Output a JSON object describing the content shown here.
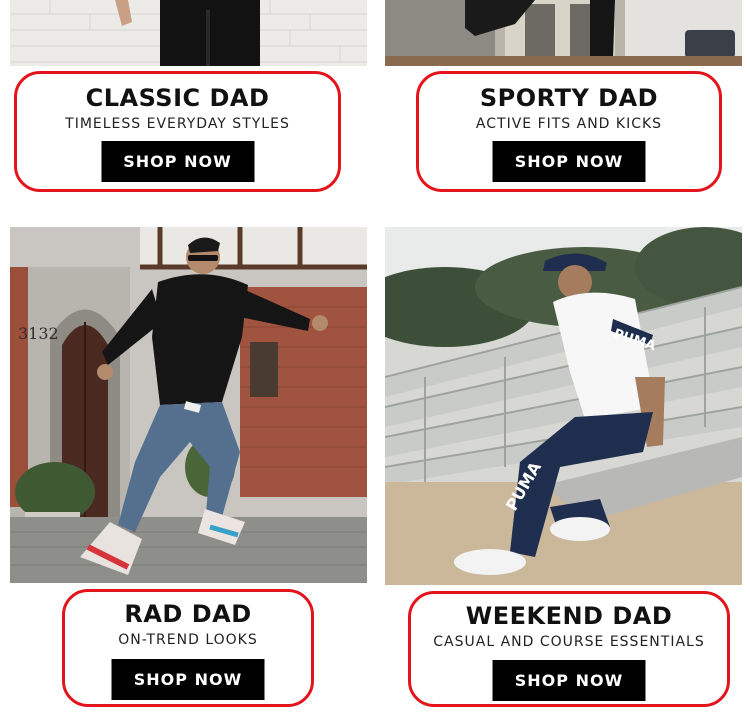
{
  "colors": {
    "frame": "#e3141b",
    "button_bg": "#000000",
    "button_text": "#ffffff"
  },
  "tiles": [
    {
      "title": "CLASSIC DAD",
      "subtitle": "TIMELESS EVERYDAY STYLES",
      "cta": "SHOP NOW"
    },
    {
      "title": "SPORTY DAD",
      "subtitle": "ACTIVE FITS AND KICKS",
      "cta": "SHOP NOW"
    },
    {
      "title": "RAD DAD",
      "subtitle": "ON-TREND LOOKS",
      "cta": "SHOP NOW"
    },
    {
      "title": "WEEKEND DAD",
      "subtitle": "CASUAL AND COURSE ESSENTIALS",
      "cta": "SHOP NOW"
    }
  ],
  "photos": {
    "building_number": "3132",
    "brand_mark": "PUMA"
  }
}
